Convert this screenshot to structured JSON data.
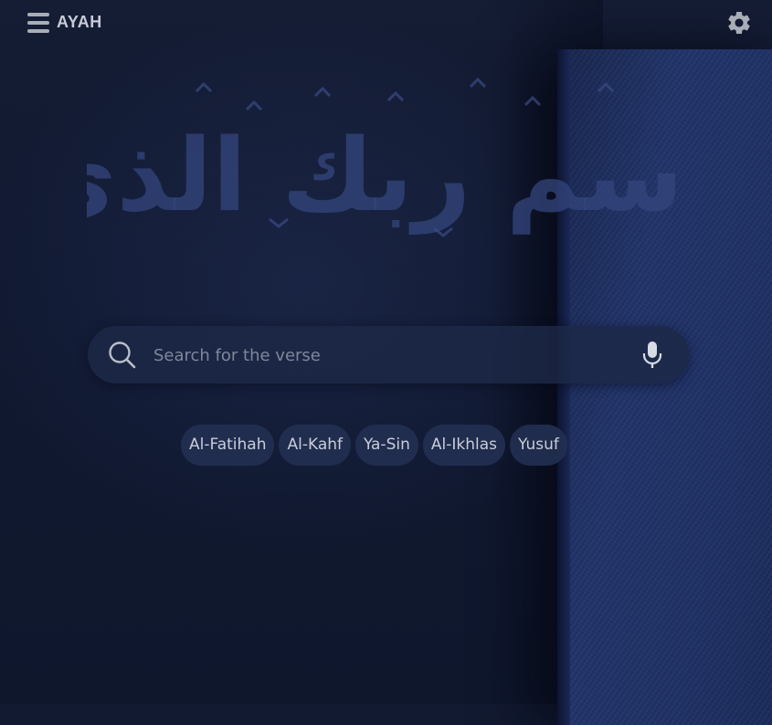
{
  "header": {
    "app_title": "AYAH",
    "menu_icon": "hamburger-menu-icon",
    "settings_icon": "gear-icon"
  },
  "hero": {
    "calligraphy_text": "اقرأ باسم ربك الذي خلق"
  },
  "search": {
    "placeholder": "Search for the verse",
    "value": "",
    "search_icon": "search-icon",
    "mic_icon": "microphone-icon"
  },
  "quick_links": [
    {
      "label": "Al-Fatihah"
    },
    {
      "label": "Al-Kahf"
    },
    {
      "label": "Ya-Sin"
    },
    {
      "label": "Al-Ikhlas"
    },
    {
      "label": "Yusuf"
    }
  ],
  "colors": {
    "background": "#121a31",
    "book": "#22346b",
    "calligraphy": "#3a4c86",
    "chip_bg": "#223052",
    "text": "#c9cdd8"
  }
}
